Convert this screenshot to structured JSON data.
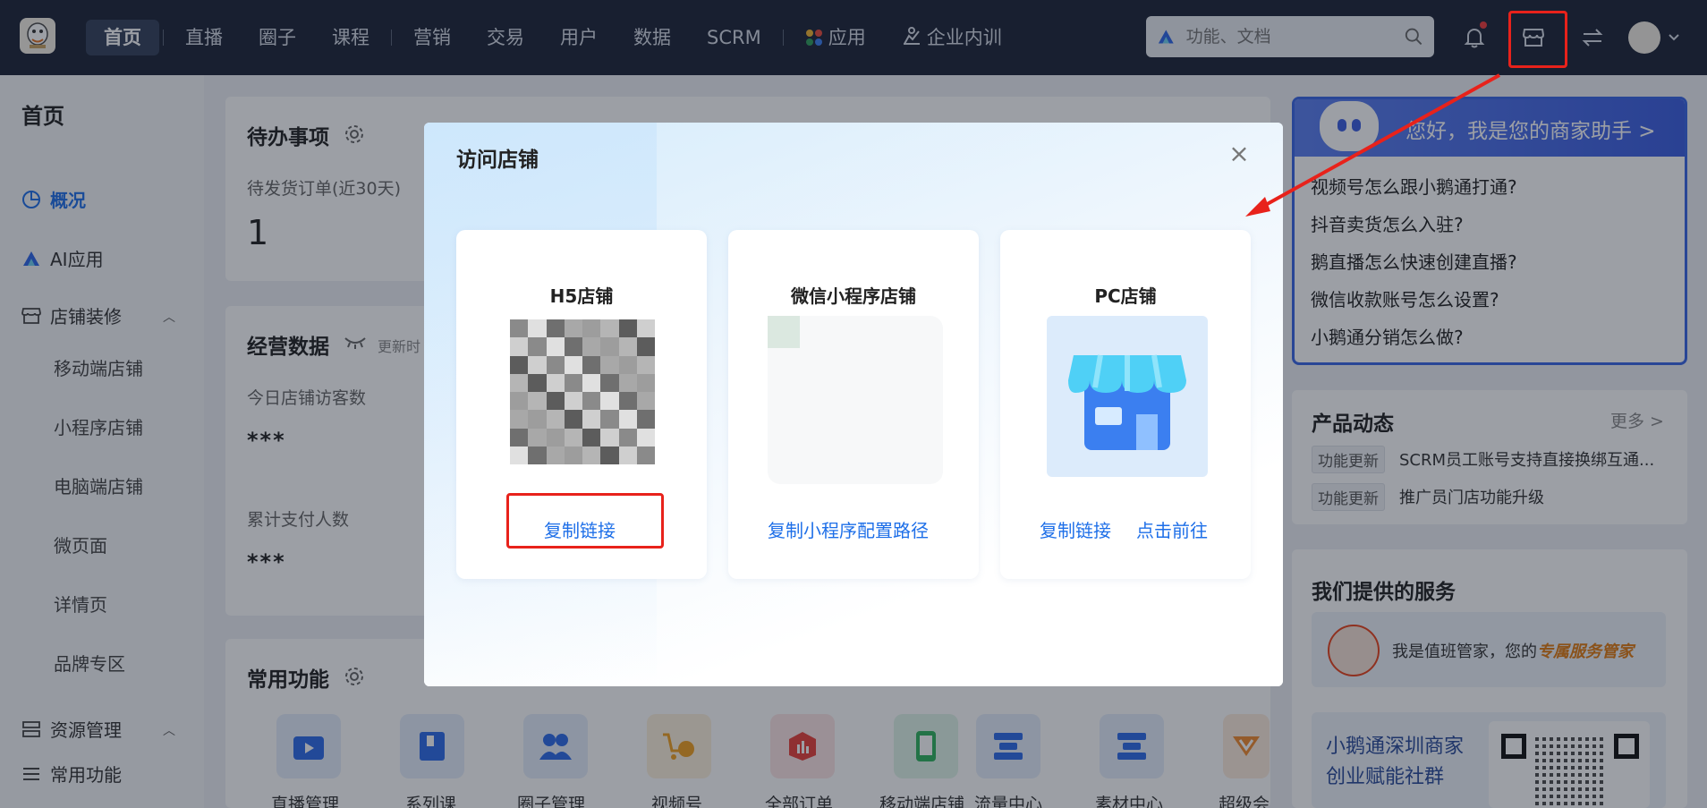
{
  "nav": {
    "items": [
      "首页",
      "直播",
      "圈子",
      "课程",
      "营销",
      "交易",
      "用户",
      "数据",
      "SCRM",
      "应用",
      "企业内训"
    ],
    "search_placeholder": "功能、文档"
  },
  "sidebar": {
    "title": "首页",
    "items": [
      {
        "label": "概况"
      },
      {
        "label": "AI应用"
      },
      {
        "label": "店铺装修"
      },
      {
        "label": "移动端店铺"
      },
      {
        "label": "小程序店铺"
      },
      {
        "label": "电脑端店铺"
      },
      {
        "label": "微页面"
      },
      {
        "label": "详情页"
      },
      {
        "label": "品牌专区"
      },
      {
        "label": "资源管理"
      },
      {
        "label": "常用功能"
      }
    ]
  },
  "main": {
    "todo_title": "待办事项",
    "todo_label": "待发货订单(近30天)",
    "todo_value": "1",
    "biz_title": "经营数据",
    "biz_update": "更新时",
    "visitors_label": "今日店铺访客数",
    "visitors_value": "***",
    "payers_label": "累计支付人数",
    "payers_value": "***",
    "common_title": "常用功能",
    "functions": [
      "直播管理",
      "系列课",
      "圈子管理",
      "视频号",
      "全部订单",
      "移动端店铺",
      "流量中心",
      "素材中心",
      "超级会"
    ]
  },
  "assistant": {
    "header": "您好，我是您的商家助手 >",
    "questions": [
      "视频号怎么跟小鹅通打通?",
      "抖音卖货怎么入驻?",
      "鹅直播怎么快速创建直播?",
      "微信收款账号怎么设置?",
      "小鹅通分销怎么做?"
    ]
  },
  "product_news": {
    "title": "产品动态",
    "more": "更多 >",
    "items": [
      {
        "tag": "功能更新",
        "text": "SCRM员工账号支持直接换绑互通..."
      },
      {
        "tag": "功能更新",
        "text": "推广员门店功能升级"
      }
    ]
  },
  "services": {
    "title": "我们提供的服务",
    "butler_text": "我是值班管家，您的",
    "butler_highlight": "专属服务管家",
    "community_line1": "小鹅通深圳商家",
    "community_line2": "创业赋能社群"
  },
  "modal": {
    "title": "访问店铺",
    "close": "×",
    "cards": [
      {
        "name": "H5店铺",
        "links": [
          "复制链接"
        ]
      },
      {
        "name": "微信小程序店铺",
        "links": [
          "复制小程序配置路径"
        ]
      },
      {
        "name": "PC店铺",
        "links": [
          "复制链接",
          "点击前往"
        ]
      }
    ]
  },
  "colors": {
    "accent": "#1e6fe8",
    "nav_bg": "#1c2436",
    "annotation_red": "#e8221b"
  }
}
